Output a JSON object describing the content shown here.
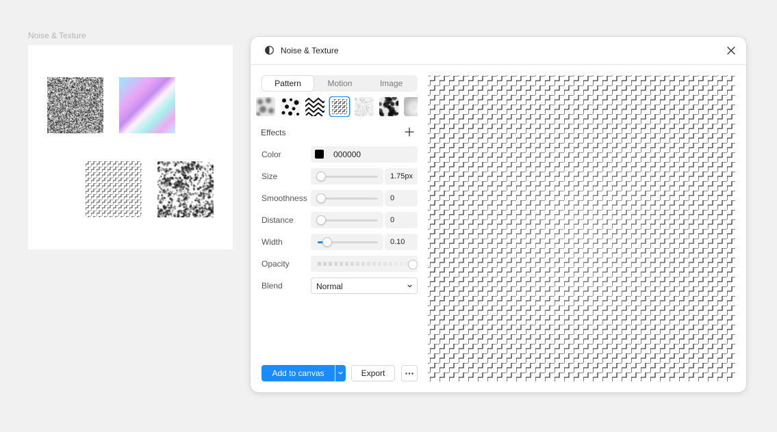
{
  "canvas": {
    "frame_label": "Noise & Texture"
  },
  "panel": {
    "title": "Noise & Texture",
    "tabs": [
      {
        "label": "Pattern",
        "active": true
      },
      {
        "label": "Motion",
        "active": false
      },
      {
        "label": "Image",
        "active": false
      }
    ],
    "effects_label": "Effects",
    "controls": {
      "color": {
        "label": "Color",
        "hex": "000000"
      },
      "size": {
        "label": "Size",
        "value": "1.75px",
        "level": 0
      },
      "smoothness": {
        "label": "Smoothness",
        "value": "0",
        "level": 0
      },
      "distance": {
        "label": "Distance",
        "value": "0",
        "level": 0
      },
      "width": {
        "label": "Width",
        "value": "0.10",
        "level": 0.1
      },
      "opacity": {
        "label": "Opacity",
        "level": 1
      },
      "blend": {
        "label": "Blend",
        "value": "Normal"
      }
    },
    "buttons": {
      "add_to_canvas": "Add to canvas",
      "export": "Export"
    }
  },
  "colors": {
    "accent": "#1a8cff",
    "pattern": "#000000"
  },
  "icons": {
    "logo": "half-circle-icon",
    "close": "close-icon",
    "add": "plus-icon",
    "chevron": "chevron-down-icon",
    "more": "more-dots-icon"
  }
}
